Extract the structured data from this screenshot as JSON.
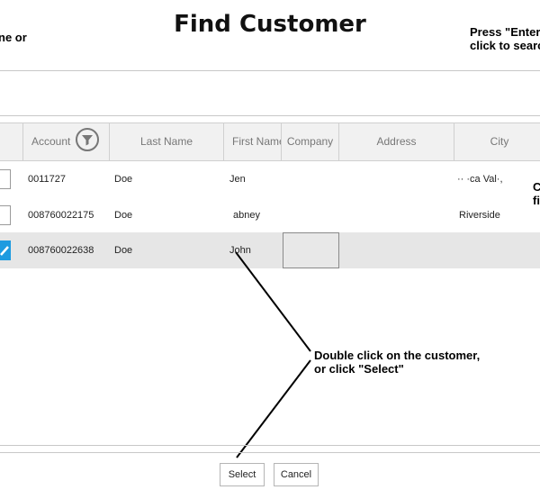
{
  "page": {
    "title": "Find Customer"
  },
  "notes": {
    "left_top": "ne or",
    "right_top": "Press \"Enter\nclick to searc",
    "right_mid": "C\nfi",
    "double_click": "Double click on the customer,\nor click \"Select\""
  },
  "table": {
    "columns": [
      "Account",
      "Last Name",
      "First Name",
      "Company",
      "Address",
      "City"
    ],
    "rows": [
      {
        "checked": false,
        "account": "0011727",
        "last_name": "Doe",
        "first_name": "Jen",
        "company": "",
        "address": "",
        "city": "·· ·ca Val·,"
      },
      {
        "checked": false,
        "account": "008760022175",
        "last_name": "Doe",
        "first_name": "abney",
        "company": "",
        "address": "",
        "city": "Riverside"
      },
      {
        "checked": true,
        "account": "008760022638",
        "last_name": "Doe",
        "first_name": "John",
        "company": "",
        "address": "",
        "city": ""
      }
    ]
  },
  "buttons": {
    "select_label": "Select",
    "cancel_label": "Cancel"
  },
  "colors": {
    "checkbox_checked": "#1e9be0",
    "selected_row": "#e6e6e6",
    "header_bg": "#f1f1f1"
  },
  "icons": {
    "filter": "filter-icon",
    "check": "checkmark-icon"
  }
}
